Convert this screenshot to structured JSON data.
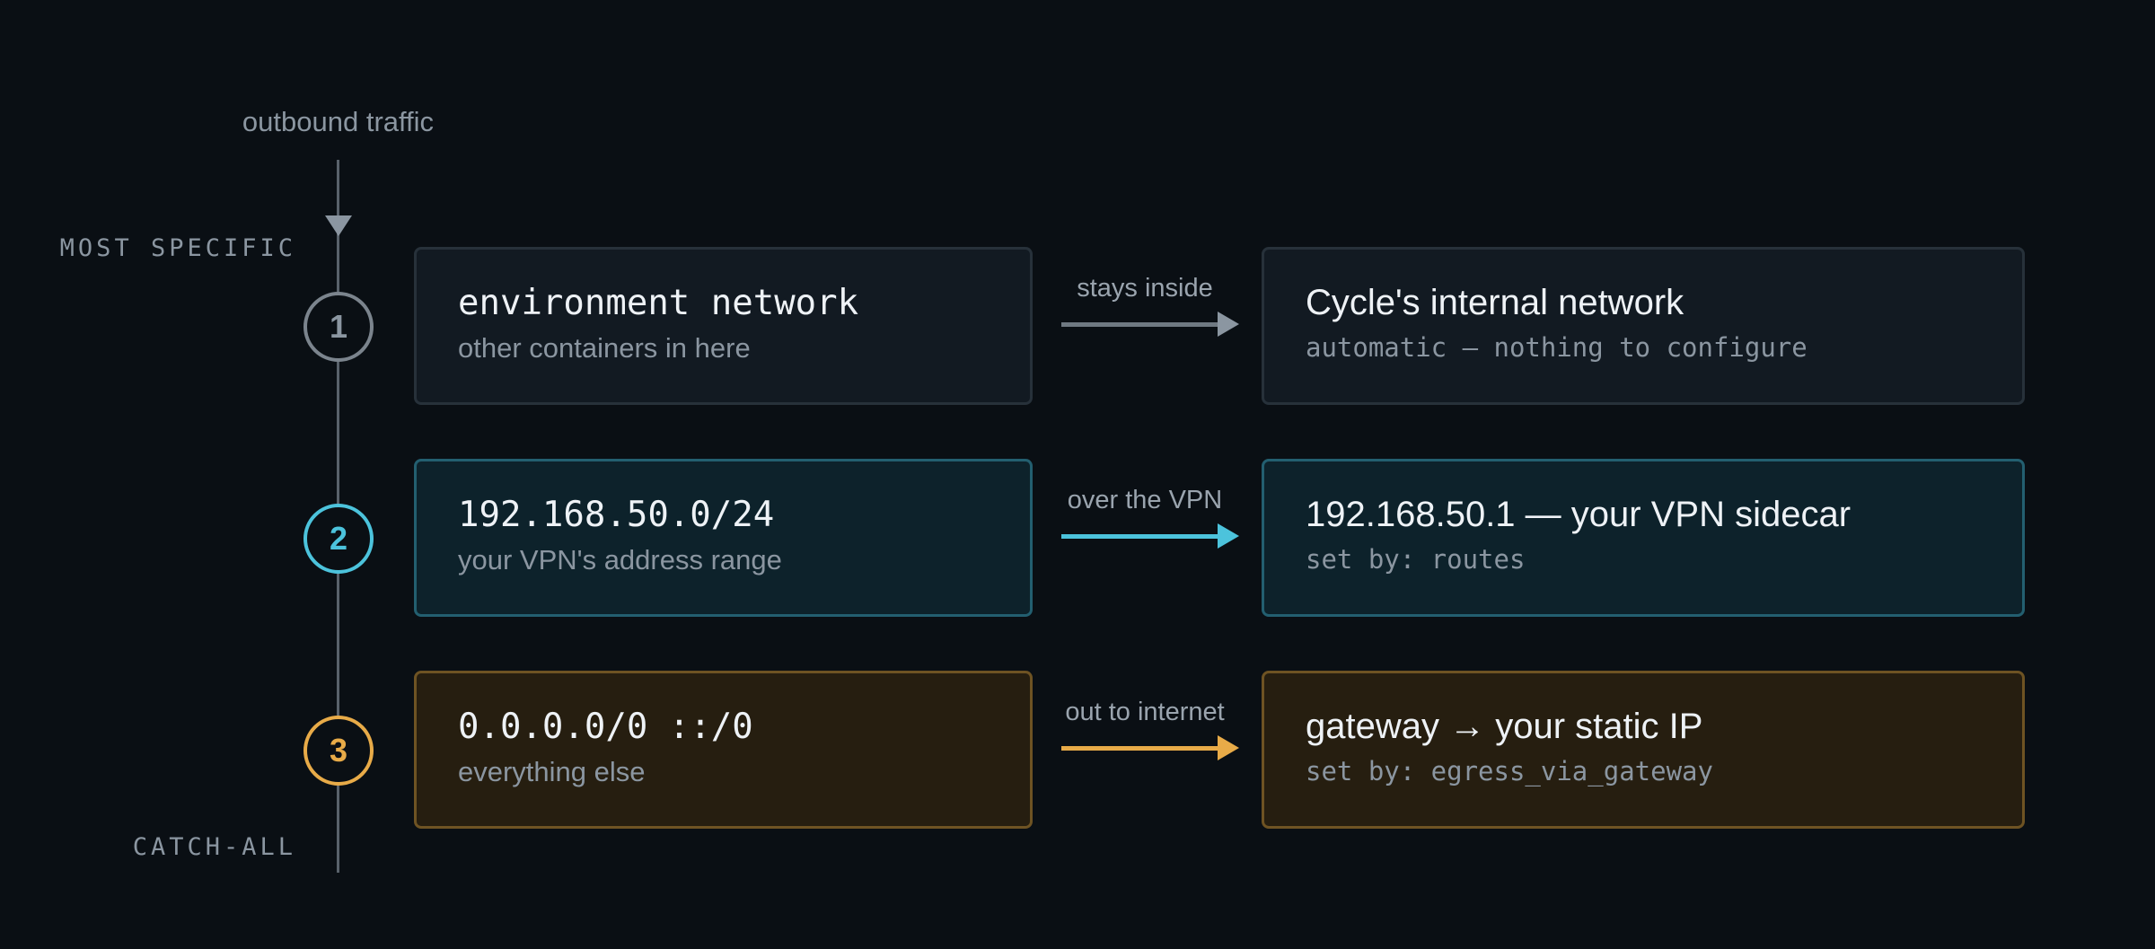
{
  "flow_label": "outbound traffic",
  "top_side_label": "MOST SPECIFIC",
  "bottom_side_label": "CATCH-ALL",
  "colors": {
    "background": "#0a0f14",
    "neutral": "#8b96a1",
    "vpn": "#4cc3dc",
    "internet": "#e8ab48"
  },
  "rules": [
    {
      "number": "1",
      "destination": "environment network",
      "destination_note": "other containers in here",
      "arrow_label": "stays inside",
      "target": "Cycle's internal network",
      "target_note": "automatic — nothing to configure"
    },
    {
      "number": "2",
      "destination": "192.168.50.0/24",
      "destination_note": "your VPN's address range",
      "arrow_label": "over the VPN",
      "target": "192.168.50.1 — your VPN sidecar",
      "target_note": "set by: routes"
    },
    {
      "number": "3",
      "destination": "0.0.0.0/0 ::/0",
      "destination_note": "everything else",
      "arrow_label": "out to internet",
      "target": "gateway → your static IP",
      "target_note": "set by: egress_via_gateway"
    }
  ]
}
